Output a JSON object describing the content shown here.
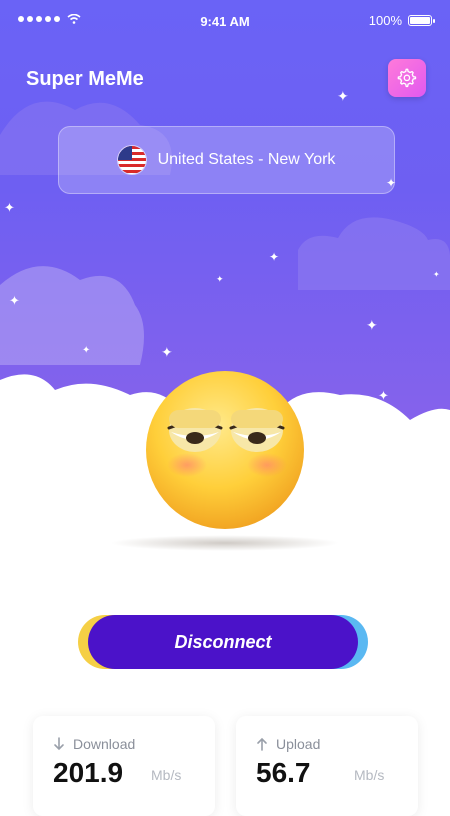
{
  "status_bar": {
    "time": "9:41 AM",
    "battery_percent": "100%"
  },
  "header": {
    "title": "Super MeMe",
    "settings_icon": "gear-icon"
  },
  "location": {
    "country_flag": "us-flag",
    "label": "United States - New York"
  },
  "action": {
    "button_label": "Disconnect"
  },
  "stats": {
    "download": {
      "label": "Download",
      "value": "201.9",
      "unit": "Mb/s",
      "icon": "arrow-down-icon"
    },
    "upload": {
      "label": "Upload",
      "value": "56.7",
      "unit": "Mb/s",
      "icon": "arrow-up-icon"
    }
  },
  "colors": {
    "sky": "#6a63f6",
    "button": "#4b12c9",
    "settings": "#e159f0",
    "accent_yellow": "#f5cf45",
    "accent_blue": "#5ab8f2"
  }
}
